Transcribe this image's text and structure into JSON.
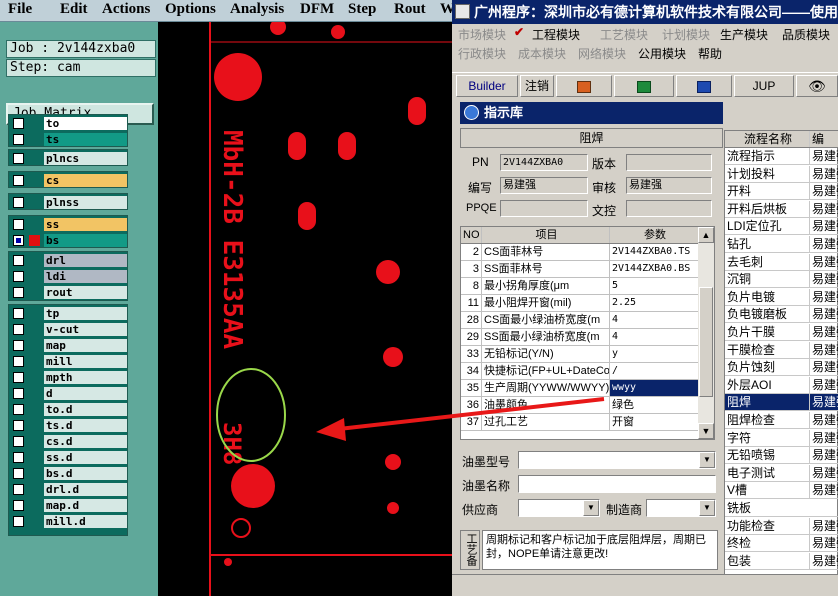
{
  "menubar": {
    "items": [
      "File",
      "Edit",
      "Actions",
      "Options",
      "Analysis",
      "DFM",
      "Step",
      "Rout",
      "W"
    ]
  },
  "left_panel": {
    "job_label": "Job : 2v144zxba0",
    "step_label": "Step: cam",
    "job_matrix_button": "Job Matrix ...",
    "layers": [
      {
        "name": "to",
        "color": "#ffffff",
        "checked": false
      },
      {
        "name": "ts",
        "color": "#129a86",
        "checked": false
      },
      {
        "name": "plncs",
        "color": "#d6e8e4",
        "checked": false
      },
      {
        "name": "cs",
        "color": "#f2c464",
        "checked": false
      },
      {
        "name": "plnss",
        "color": "#d6e8e4",
        "checked": false
      },
      {
        "name": "ss",
        "color": "#f2c464",
        "checked": false
      },
      {
        "name": "bs",
        "color": "#129a86",
        "checked": true
      },
      {
        "name": "drl",
        "color": "#b0b8c4",
        "checked": false
      },
      {
        "name": "ldi",
        "color": "#b0b8c4",
        "checked": false
      },
      {
        "name": "rout",
        "color": "#b0b8c4",
        "checked": false
      },
      {
        "name": "tp",
        "color": "#d6e8e4",
        "checked": false
      },
      {
        "name": "v-cut",
        "color": "#d6e8e4",
        "checked": false
      },
      {
        "name": "map",
        "color": "#d6e8e4",
        "checked": false
      },
      {
        "name": "mill",
        "color": "#d6e8e4",
        "checked": false
      },
      {
        "name": "mpth",
        "color": "#d6e8e4",
        "checked": false
      },
      {
        "name": "d",
        "color": "#d6e8e4",
        "checked": false
      },
      {
        "name": "to.d",
        "color": "#d6e8e4",
        "checked": false
      },
      {
        "name": "ts.d",
        "color": "#d6e8e4",
        "checked": false
      },
      {
        "name": "cs.d",
        "color": "#d6e8e4",
        "checked": false
      },
      {
        "name": "ss.d",
        "color": "#d6e8e4",
        "checked": false
      },
      {
        "name": "bs.d",
        "color": "#d6e8e4",
        "checked": false
      },
      {
        "name": "drl.d",
        "color": "#d6e8e4",
        "checked": false
      },
      {
        "name": "map.d",
        "color": "#d6e8e4",
        "checked": false
      },
      {
        "name": "mill.d",
        "color": "#d6e8e4",
        "checked": false
      }
    ]
  },
  "canvas": {
    "board_text_1": "MbH-2B E3135AA",
    "board_text_2": "3H8",
    "copper_color": "#e8101a",
    "highlight_color": "#9ad84a"
  },
  "right_window": {
    "title": "广州程序：深圳市必有德计算机软件技术有限公司——使用",
    "menu_row1": [
      "市场模块",
      "工程模块",
      "工艺模块",
      "计划模块",
      "生产模块",
      "品质模块"
    ],
    "menu_row2": [
      "行政模块",
      "成本模块",
      "网络模块",
      "公用模块",
      "帮助"
    ],
    "toolbar": {
      "builder": "Builder",
      "logout": "注销",
      "jup": "JUP"
    },
    "dialog": {
      "title": "指示库",
      "section": "阻焊",
      "pn_label": "PN",
      "pn_value": "2V144ZXBA0",
      "version_label": "版本",
      "author_label": "编写",
      "author_value": "易建强",
      "audit_label": "审核",
      "audit_value": "易建强",
      "ppqe_label": "PPQE",
      "doc_label": "文控",
      "grid_headers": [
        "NO",
        "项目",
        "参数"
      ],
      "grid_rows": [
        {
          "no": "2",
          "item": "CS面菲林号",
          "param": "2V144ZXBA0.TS"
        },
        {
          "no": "3",
          "item": "SS面菲林号",
          "param": "2V144ZXBA0.BS"
        },
        {
          "no": "8",
          "item": "最小拐角厚度(μm",
          "param": "5"
        },
        {
          "no": "11",
          "item": "最小阻焊开窗(mil)",
          "param": "2.25"
        },
        {
          "no": "28",
          "item": "CS面最小绿油桥宽度(m",
          "param": "4"
        },
        {
          "no": "29",
          "item": "SS面最小绿油桥宽度(m",
          "param": "4"
        },
        {
          "no": "33",
          "item": "无铅标记(Y/N)",
          "param": "y"
        },
        {
          "no": "34",
          "item": "快捷标记(FP+UL+DateCo",
          "param": "/"
        },
        {
          "no": "35",
          "item": "生产周期(YYWW/WWYY)",
          "param": "wwyy"
        },
        {
          "no": "36",
          "item": "油墨颜色",
          "param": "绿色"
        },
        {
          "no": "37",
          "item": "过孔工艺",
          "param": "开窗"
        }
      ],
      "ink_model_label": "油墨型号",
      "ink_name_label": "油墨名称",
      "supplier_label": "供应商",
      "maker_label": "制造商",
      "remark_label": "工艺备",
      "remark_text": "周期标记和客户标记加于底层阻焊层，周期已封，NOPE单请注意更改!"
    },
    "flow": {
      "headers": [
        "流程名称",
        "编"
      ],
      "rows": [
        {
          "name": "流程指示",
          "who": "易建强"
        },
        {
          "name": "计划投料",
          "who": "易建强"
        },
        {
          "name": "开料",
          "who": "易建强"
        },
        {
          "name": "开料后烘板",
          "who": "易建强"
        },
        {
          "name": "LDI定位孔",
          "who": "易建强"
        },
        {
          "name": "钻孔",
          "who": "易建强"
        },
        {
          "name": "去毛刺",
          "who": "易建强"
        },
        {
          "name": "沉铜",
          "who": "易建强"
        },
        {
          "name": "负片电镀",
          "who": "易建强"
        },
        {
          "name": "负电镀磨板",
          "who": "易建强"
        },
        {
          "name": "负片干膜",
          "who": "易建强"
        },
        {
          "name": "干膜检查",
          "who": "易建强"
        },
        {
          "name": "负片蚀刻",
          "who": "易建强"
        },
        {
          "name": "外层AOI",
          "who": "易建强"
        },
        {
          "name": "阻焊",
          "who": "易建强"
        },
        {
          "name": "阻焊检查",
          "who": "易建强"
        },
        {
          "name": "字符",
          "who": "易建强"
        },
        {
          "name": "无铅喷锡",
          "who": "易建强"
        },
        {
          "name": "电子测试",
          "who": "易建强"
        },
        {
          "name": "V槽",
          "who": "易建强"
        },
        {
          "name": "铣板",
          "who": ""
        },
        {
          "name": "功能检查",
          "who": "易建强"
        },
        {
          "name": "终检",
          "who": "易建强"
        },
        {
          "name": "包装",
          "who": "易建强"
        }
      ]
    }
  }
}
